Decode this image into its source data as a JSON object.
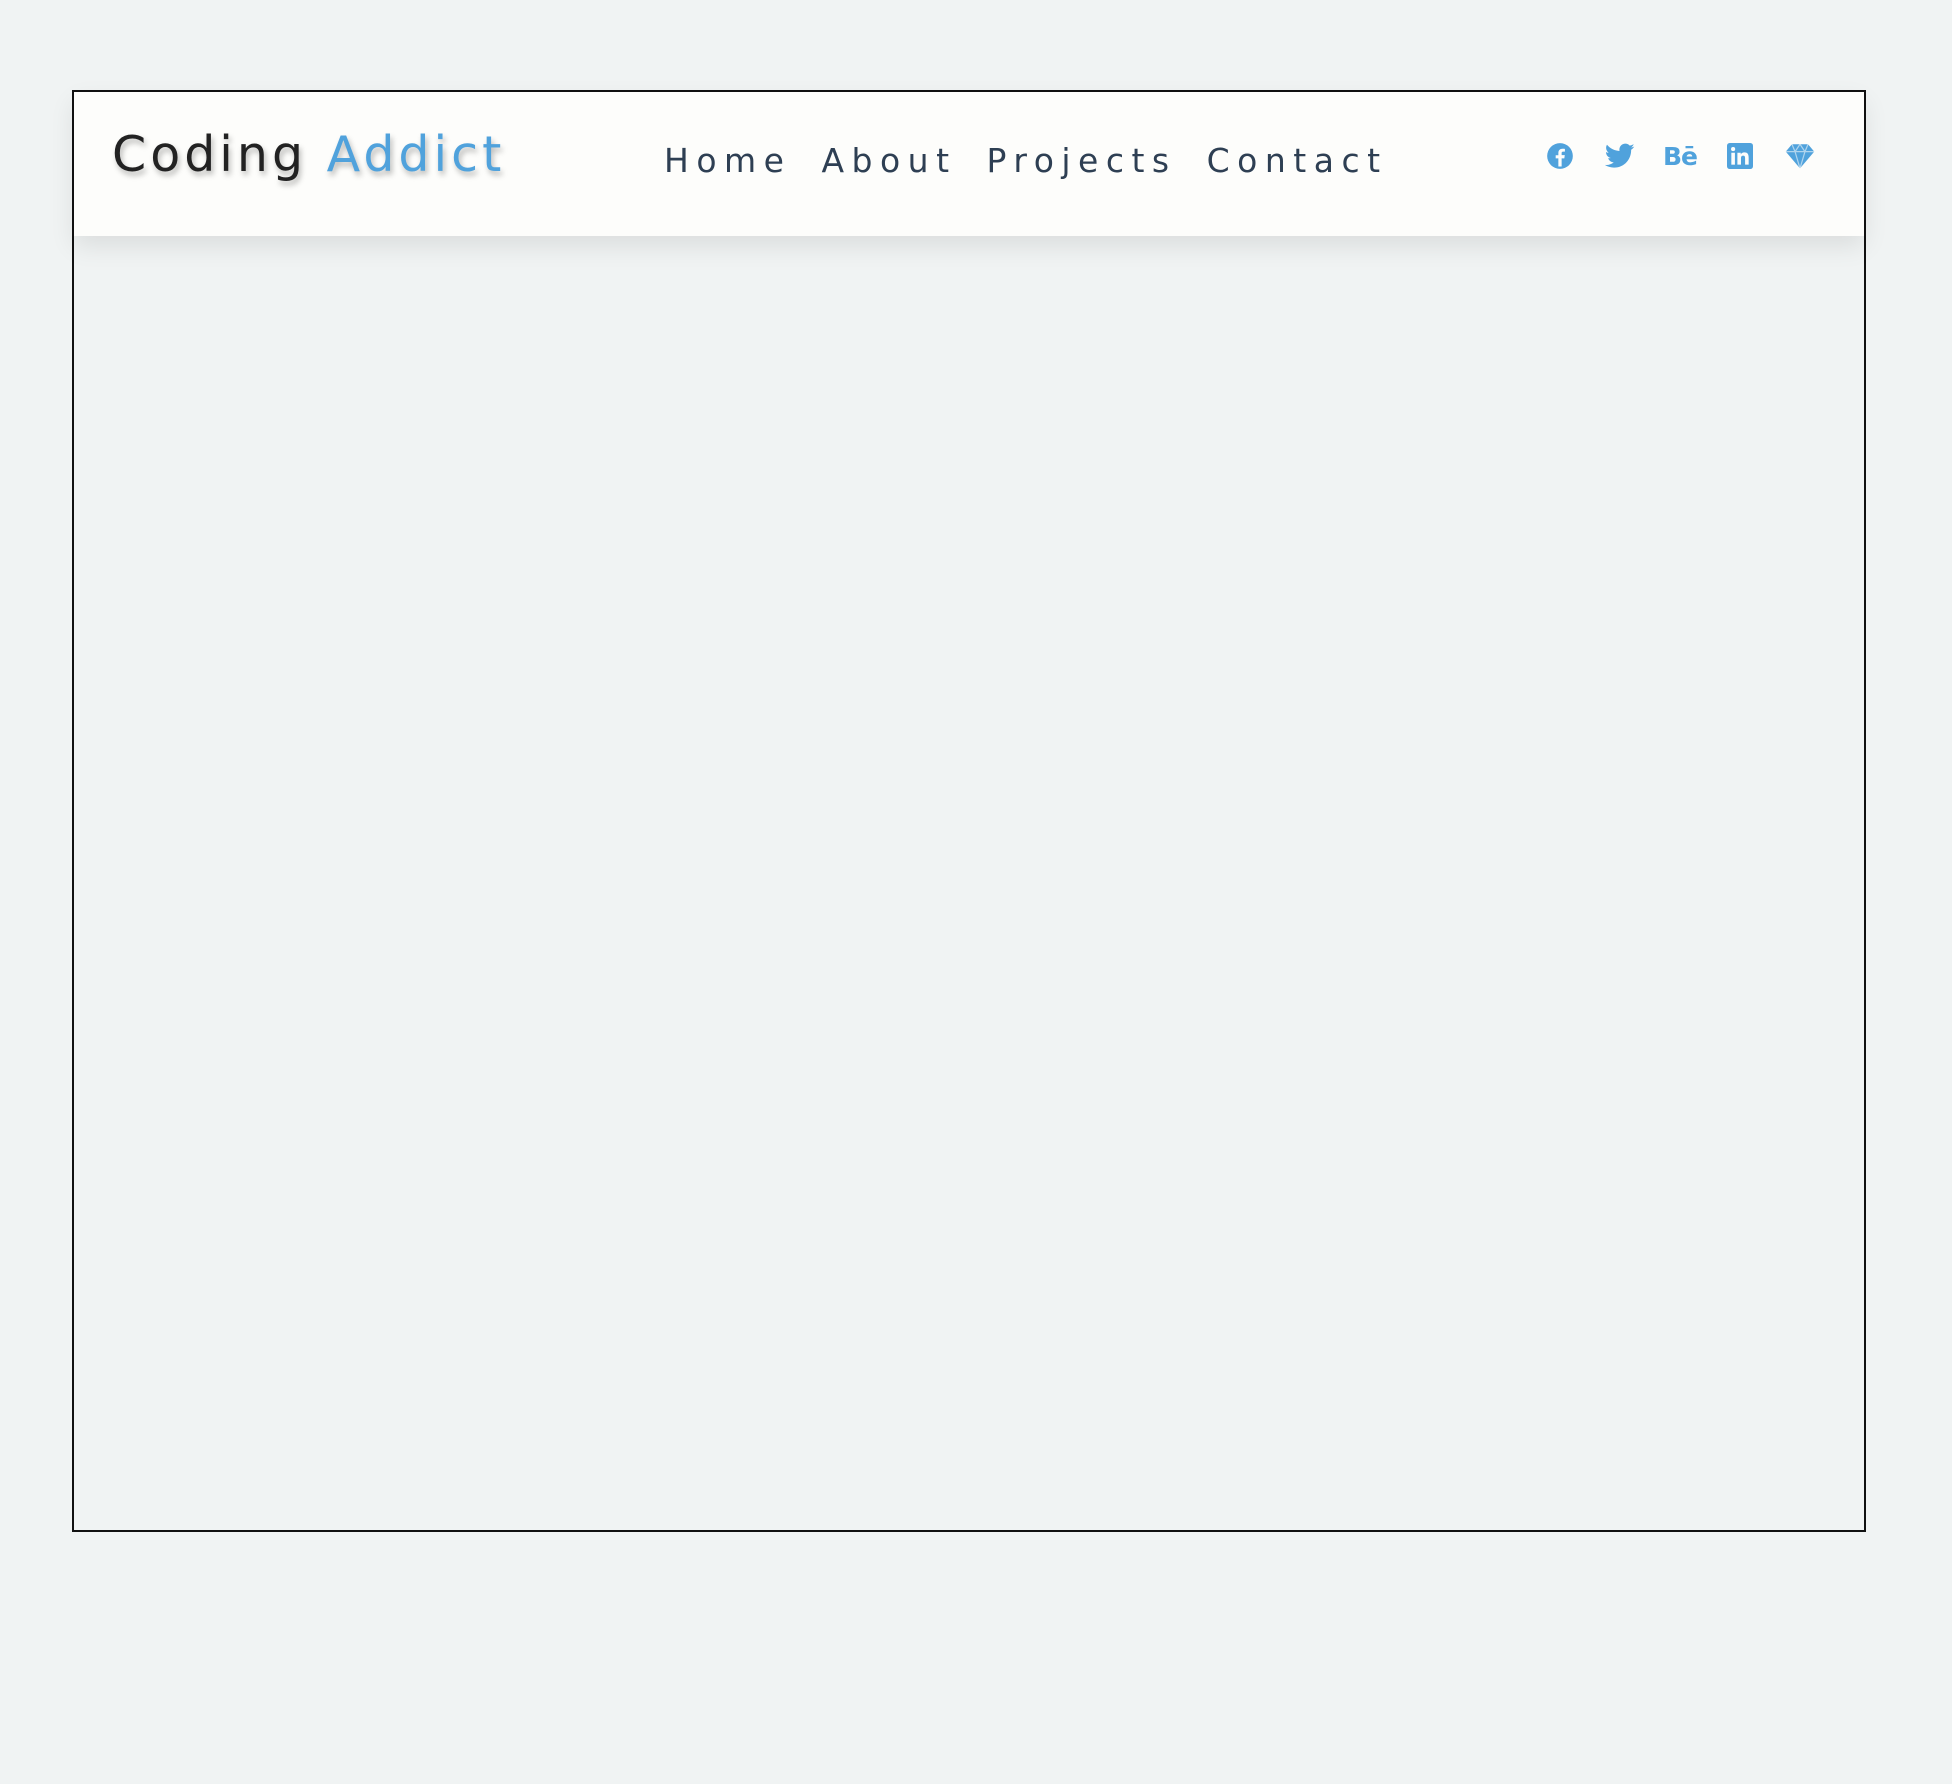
{
  "brand": {
    "first": "Coding",
    "second": "Addict",
    "accent_color": "#50a2dc",
    "dark_color": "#222222"
  },
  "nav": {
    "links": [
      {
        "label": "Home"
      },
      {
        "label": "About"
      },
      {
        "label": "Projects"
      },
      {
        "label": "Contact"
      }
    ],
    "text_color": "#2e3f53"
  },
  "social": {
    "icons": [
      "facebook-icon",
      "twitter-icon",
      "behance-icon",
      "linkedin-icon",
      "sketch-icon"
    ],
    "behance_glyph": "Bē",
    "color": "#50a2dc"
  }
}
